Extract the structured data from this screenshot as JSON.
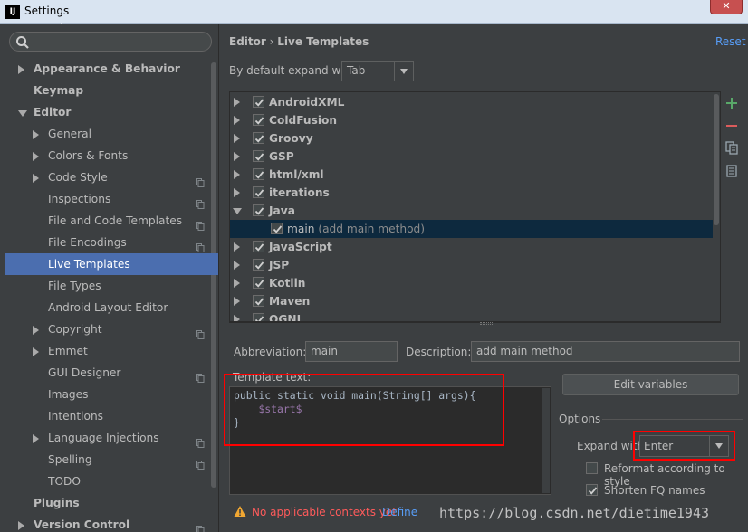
{
  "window": {
    "title": "Settings",
    "app_icon_text": "IJ",
    "close_symbol": "✕"
  },
  "search": {
    "placeholder": ""
  },
  "tree": [
    {
      "label": "Appearance & Behavior",
      "level": 0,
      "arrow": "right",
      "bold": true,
      "copy": false
    },
    {
      "label": "Keymap",
      "level": 0,
      "arrow": "none",
      "bold": true,
      "copy": false
    },
    {
      "label": "Editor",
      "level": 0,
      "arrow": "down",
      "bold": true,
      "copy": false
    },
    {
      "label": "General",
      "level": 1,
      "arrow": "right",
      "bold": false,
      "copy": false
    },
    {
      "label": "Colors & Fonts",
      "level": 1,
      "arrow": "right",
      "bold": false,
      "copy": false
    },
    {
      "label": "Code Style",
      "level": 1,
      "arrow": "right",
      "bold": false,
      "copy": true
    },
    {
      "label": "Inspections",
      "level": 1,
      "arrow": "none",
      "bold": false,
      "copy": true
    },
    {
      "label": "File and Code Templates",
      "level": 1,
      "arrow": "none",
      "bold": false,
      "copy": true
    },
    {
      "label": "File Encodings",
      "level": 1,
      "arrow": "none",
      "bold": false,
      "copy": true
    },
    {
      "label": "Live Templates",
      "level": 1,
      "arrow": "none",
      "bold": false,
      "copy": false,
      "selected": true
    },
    {
      "label": "File Types",
      "level": 1,
      "arrow": "none",
      "bold": false,
      "copy": false
    },
    {
      "label": "Android Layout Editor",
      "level": 1,
      "arrow": "none",
      "bold": false,
      "copy": false
    },
    {
      "label": "Copyright",
      "level": 1,
      "arrow": "right",
      "bold": false,
      "copy": true
    },
    {
      "label": "Emmet",
      "level": 1,
      "arrow": "right",
      "bold": false,
      "copy": false
    },
    {
      "label": "GUI Designer",
      "level": 1,
      "arrow": "none",
      "bold": false,
      "copy": true
    },
    {
      "label": "Images",
      "level": 1,
      "arrow": "none",
      "bold": false,
      "copy": false
    },
    {
      "label": "Intentions",
      "level": 1,
      "arrow": "none",
      "bold": false,
      "copy": false
    },
    {
      "label": "Language Injections",
      "level": 1,
      "arrow": "right",
      "bold": false,
      "copy": true
    },
    {
      "label": "Spelling",
      "level": 1,
      "arrow": "none",
      "bold": false,
      "copy": true
    },
    {
      "label": "TODO",
      "level": 1,
      "arrow": "none",
      "bold": false,
      "copy": false
    },
    {
      "label": "Plugins",
      "level": 0,
      "arrow": "none",
      "bold": true,
      "copy": false
    },
    {
      "label": "Version Control",
      "level": 0,
      "arrow": "right",
      "bold": true,
      "copy": true
    }
  ],
  "breadcrumb": {
    "parent": "Editor",
    "separator": "›",
    "current": "Live Templates"
  },
  "reset_label": "Reset",
  "expand": {
    "label": "By default expand with",
    "value": "Tab"
  },
  "templates": [
    {
      "name": "AndroidXML",
      "expanded": false,
      "checked": true
    },
    {
      "name": "ColdFusion",
      "expanded": false,
      "checked": true
    },
    {
      "name": "Groovy",
      "expanded": false,
      "checked": true
    },
    {
      "name": "GSP",
      "expanded": false,
      "checked": true
    },
    {
      "name": "html/xml",
      "expanded": false,
      "checked": true
    },
    {
      "name": "iterations",
      "expanded": false,
      "checked": true
    },
    {
      "name": "Java",
      "expanded": true,
      "checked": true
    },
    {
      "name": "main",
      "child": true,
      "desc": "(add main method)",
      "checked": true
    },
    {
      "name": "JavaScript",
      "expanded": false,
      "checked": true
    },
    {
      "name": "JSP",
      "expanded": false,
      "checked": true
    },
    {
      "name": "Kotlin",
      "expanded": false,
      "checked": true
    },
    {
      "name": "Maven",
      "expanded": false,
      "checked": true
    },
    {
      "name": "OGNL",
      "expanded": false,
      "checked": true
    }
  ],
  "details": {
    "abbreviation_label": "Abbreviation:",
    "abbreviation_value": "main",
    "description_label": "Description:",
    "description_value": "add main method",
    "template_text_label": "Template text:",
    "code_line1": "public static void main(String[] args){",
    "code_line2": "$start$",
    "code_line3": "}",
    "edit_variables_label": "Edit variables",
    "options_label": "Options",
    "expand_with_label": "Expand with",
    "expand_with_value": "Enter",
    "reformat_label": "Reformat according to style",
    "reformat_checked": false,
    "shorten_label": "Shorten FQ names",
    "shorten_checked": true,
    "warning_text": "No applicable contexts yet.",
    "define_label": "Define"
  },
  "watermark": "https://blog.csdn.net/dietime1943",
  "colors": {
    "accent": "#4b6eaf",
    "link": "#589df6",
    "warning": "#ff5b5b",
    "highlight_box": "#ff0000"
  }
}
